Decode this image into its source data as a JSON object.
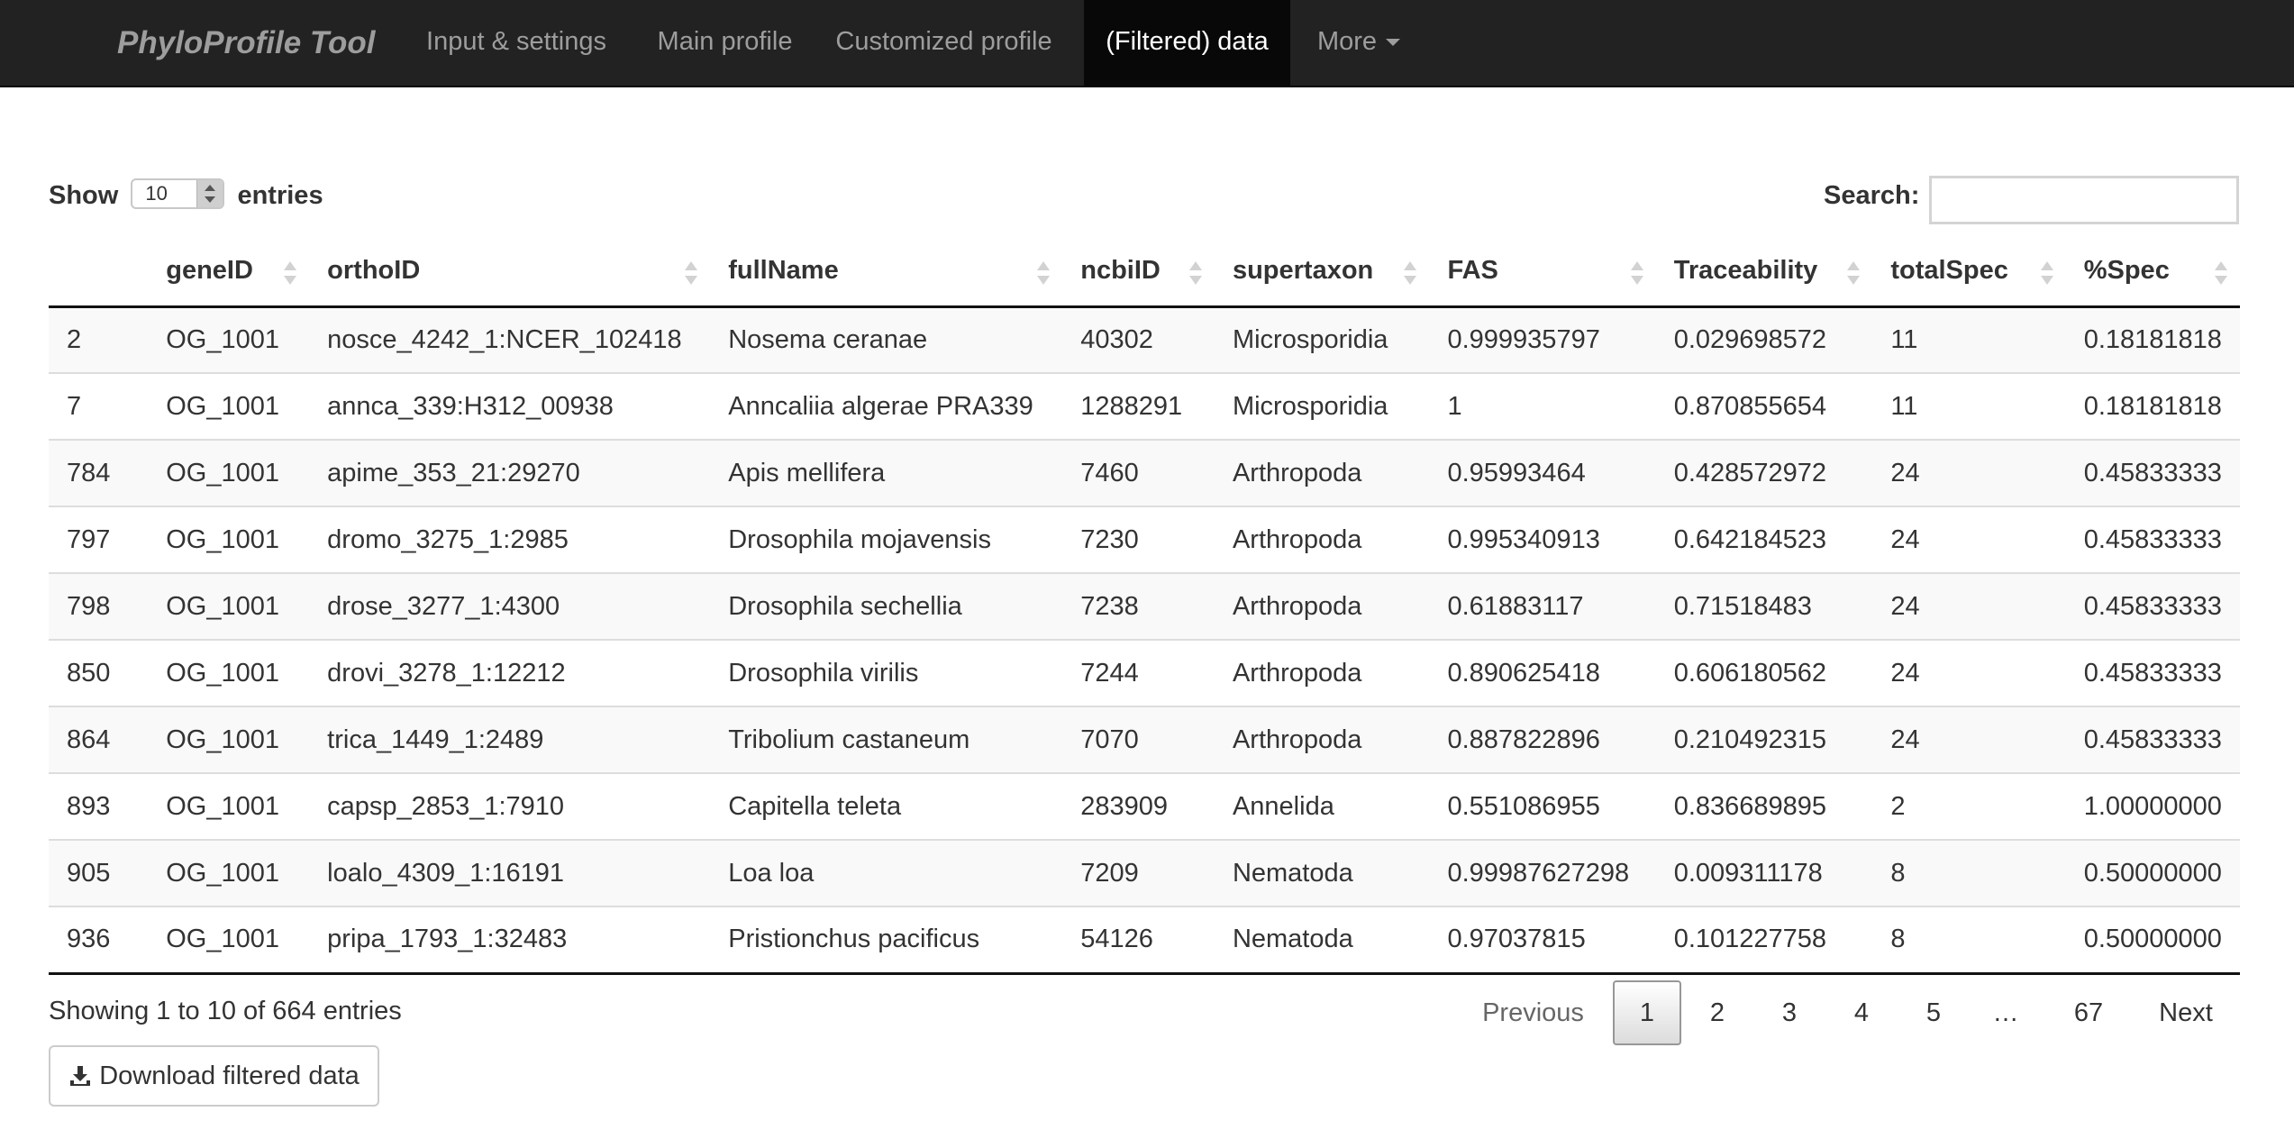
{
  "navbar": {
    "brand": "PhyloProfile Tool",
    "items": [
      {
        "label": "Input & settings"
      },
      {
        "label": "Main profile"
      },
      {
        "label": "Customized profile"
      },
      {
        "label": "(Filtered) data",
        "active": true
      },
      {
        "label": "More",
        "icon": "caret-down-icon"
      }
    ]
  },
  "controls": {
    "show_label": "Show",
    "entries_value": "10",
    "entries_label": "entries",
    "search_label": "Search:",
    "search_value": ""
  },
  "table": {
    "columns": [
      "",
      "geneID",
      "orthoID",
      "fullName",
      "ncbiID",
      "supertaxon",
      "FAS",
      "Traceability",
      "totalSpec",
      "%Spec"
    ],
    "rows": [
      [
        "2",
        "OG_1001",
        "nosce_4242_1:NCER_102418",
        "Nosema ceranae",
        "40302",
        "Microsporidia",
        "0.999935797",
        "0.029698572",
        "11",
        "0.18181818"
      ],
      [
        "7",
        "OG_1001",
        "annca_339:H312_00938",
        "Anncaliia algerae PRA339",
        "1288291",
        "Microsporidia",
        "1",
        "0.870855654",
        "11",
        "0.18181818"
      ],
      [
        "784",
        "OG_1001",
        "apime_353_21:29270",
        "Apis mellifera",
        "7460",
        "Arthropoda",
        "0.95993464",
        "0.428572972",
        "24",
        "0.45833333"
      ],
      [
        "797",
        "OG_1001",
        "dromo_3275_1:2985",
        "Drosophila mojavensis",
        "7230",
        "Arthropoda",
        "0.995340913",
        "0.642184523",
        "24",
        "0.45833333"
      ],
      [
        "798",
        "OG_1001",
        "drose_3277_1:4300",
        "Drosophila sechellia",
        "7238",
        "Arthropoda",
        "0.61883117",
        "0.71518483",
        "24",
        "0.45833333"
      ],
      [
        "850",
        "OG_1001",
        "drovi_3278_1:12212",
        "Drosophila virilis",
        "7244",
        "Arthropoda",
        "0.890625418",
        "0.606180562",
        "24",
        "0.45833333"
      ],
      [
        "864",
        "OG_1001",
        "trica_1449_1:2489",
        "Tribolium castaneum",
        "7070",
        "Arthropoda",
        "0.887822896",
        "0.210492315",
        "24",
        "0.45833333"
      ],
      [
        "893",
        "OG_1001",
        "capsp_2853_1:7910",
        "Capitella teleta",
        "283909",
        "Annelida",
        "0.551086955",
        "0.836689895",
        "2",
        "1.00000000"
      ],
      [
        "905",
        "OG_1001",
        "loalo_4309_1:16191",
        "Loa loa",
        "7209",
        "Nematoda",
        "0.99987627298",
        "0.009311178",
        "8",
        "0.50000000"
      ],
      [
        "936",
        "OG_1001",
        "pripa_1793_1:32483",
        "Pristionchus pacificus",
        "54126",
        "Nematoda",
        "0.97037815",
        "0.101227758",
        "8",
        "0.50000000"
      ]
    ]
  },
  "footer": {
    "info": "Showing 1 to 10 of 664 entries",
    "pagination": {
      "previous": "Previous",
      "pages": [
        "1",
        "2",
        "3",
        "4",
        "5"
      ],
      "current_page": "1",
      "ellipsis": "…",
      "last_page": "67",
      "next": "Next"
    },
    "download_label": "Download filtered data",
    "download_icon": "download-icon"
  }
}
